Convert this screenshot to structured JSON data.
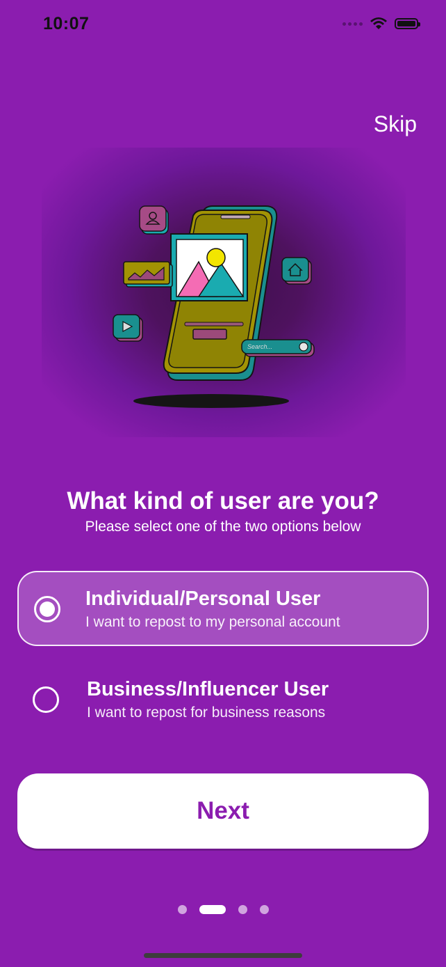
{
  "status_bar": {
    "time": "10:07"
  },
  "header": {
    "skip_label": "Skip"
  },
  "illustration": {
    "search_placeholder": "Search..."
  },
  "question": {
    "title": "What kind of user are you?",
    "subtitle": "Please select one of the two options below"
  },
  "options": [
    {
      "title": "Individual/Personal User",
      "description": "I want to repost to my personal account",
      "selected": true
    },
    {
      "title": "Business/Influencer User",
      "description": "I want to repost for business reasons",
      "selected": false
    }
  ],
  "next_label": "Next",
  "pagination": {
    "total": 4,
    "active_index": 1
  },
  "colors": {
    "background": "#8b1daf",
    "accent": "#8b1daf",
    "surface": "#ffffff"
  }
}
